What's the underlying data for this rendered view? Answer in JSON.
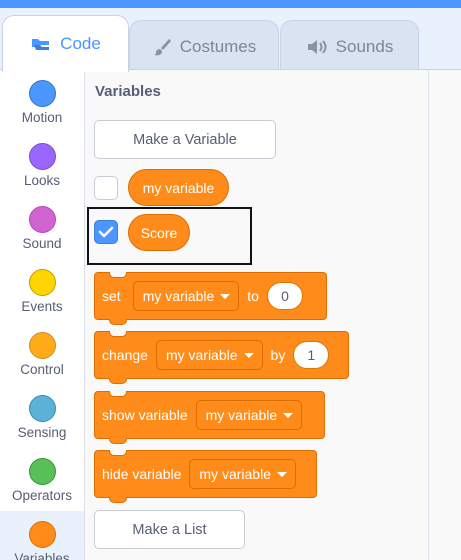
{
  "tabs": [
    {
      "label": "Code",
      "icon": "code-blocks-icon"
    },
    {
      "label": "Costumes",
      "icon": "paintbrush-icon"
    },
    {
      "label": "Sounds",
      "icon": "speaker-icon"
    }
  ],
  "categories": [
    {
      "label": "Motion",
      "color": "#4c97ff"
    },
    {
      "label": "Looks",
      "color": "#9966ff"
    },
    {
      "label": "Sound",
      "color": "#cf63cf"
    },
    {
      "label": "Events",
      "color": "#ffd500"
    },
    {
      "label": "Control",
      "color": "#ffab19"
    },
    {
      "label": "Sensing",
      "color": "#5cb1d6"
    },
    {
      "label": "Operators",
      "color": "#59c059"
    },
    {
      "label": "Variables",
      "color": "#ff8c1a"
    }
  ],
  "palette": {
    "heading": "Variables",
    "make_variable": "Make a Variable",
    "variables": [
      {
        "name": "my variable",
        "checked": false
      },
      {
        "name": "Score",
        "checked": true
      }
    ],
    "blocks": {
      "set": {
        "label": "set",
        "var": "my variable",
        "to": "to",
        "value": "0"
      },
      "change": {
        "label": "change",
        "var": "my variable",
        "by": "by",
        "value": "1"
      },
      "show": {
        "label": "show variable",
        "var": "my variable"
      },
      "hide": {
        "label": "hide variable",
        "var": "my variable"
      }
    },
    "make_list": "Make a List"
  },
  "colors": {
    "accent": "#4c97ff",
    "variables": "#ff8c1a"
  }
}
